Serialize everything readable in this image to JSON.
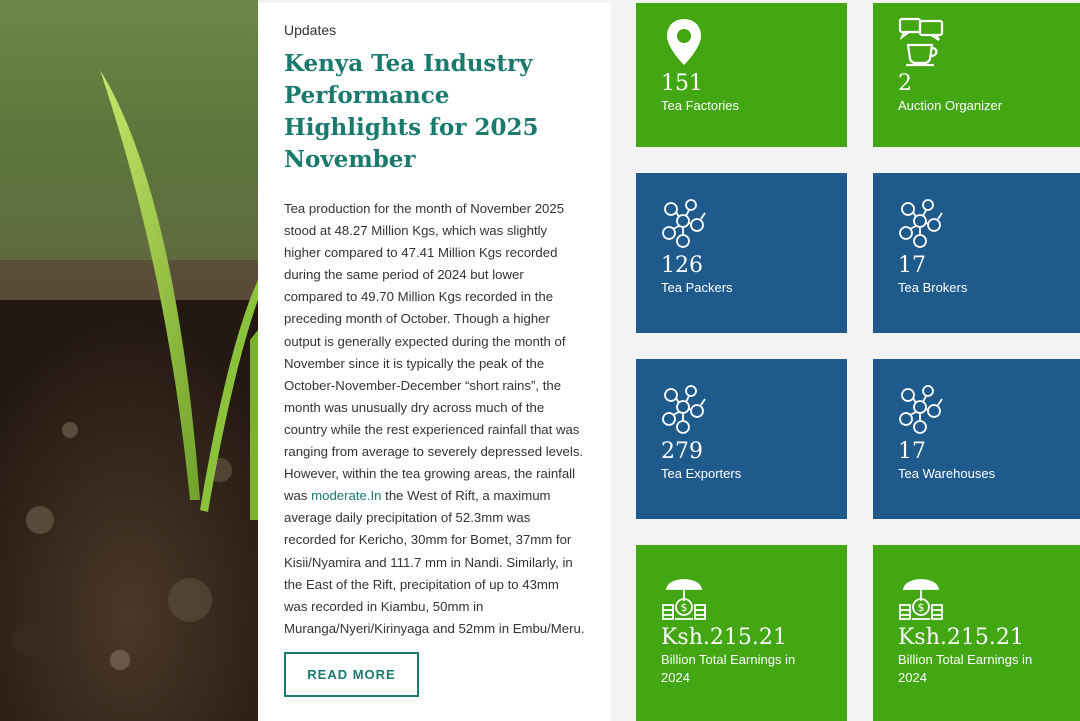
{
  "article": {
    "kicker": "Updates",
    "title": "Kenya Tea Industry Performance Highlights for 2025 November",
    "body_before_link": "Tea production for the month of November 2025 stood at 48.27 Million Kgs, which was slightly higher compared to 47.41 Million Kgs recorded during the same period of 2024 but lower compared to 49.70 Million Kgs recorded in the preceding month of October. Though a higher output is generally expected during the month of November since it is typically the peak of the October-November-December “short rains”, the month was unusually dry across much of the country while the rest experienced rainfall that was ranging from average to severely depressed levels. However, within the tea growing areas, the rainfall was ",
    "body_link": "moderate.In",
    "body_after_link": " the West of Rift, a maximum average daily precipitation of 52.3mm was recorded for Kericho, 30mm for Bomet, 37mm for Kisii/Nyamira and 111.7 mm in Nandi. Similarly, in the East of the Rift, precipitation of up to 43mm was recorded in Kiambu, 50mm in Muranga/Nyeri/Kirinyaga and 52mm in Embu/Meru.",
    "read_more": "READ MORE"
  },
  "stats": [
    {
      "value": "151",
      "label": "Tea Factories",
      "icon": "location-pin-icon",
      "color": "#43a613"
    },
    {
      "value": "2",
      "label": "Auction Organizer",
      "icon": "chat-cup-icon",
      "color": "#43a613"
    },
    {
      "value": "126",
      "label": "Tea Packers",
      "icon": "network-people-icon",
      "color": "#1f5a8c"
    },
    {
      "value": "17",
      "label": "Tea Brokers",
      "icon": "network-people-icon",
      "color": "#1f5a8c"
    },
    {
      "value": "279",
      "label": "Tea Exporters",
      "icon": "network-people-icon",
      "color": "#1f5a8c"
    },
    {
      "value": "17",
      "label": "Tea Warehouses",
      "icon": "network-people-icon",
      "color": "#1f5a8c"
    },
    {
      "value": "Ksh.215.21",
      "label": "Billion Total Earnings in 2024",
      "icon": "money-umbrella-icon",
      "color": "#43a613"
    },
    {
      "value": "Ksh.215.21",
      "label": "Billion Total Earnings in 2024",
      "icon": "money-umbrella-icon",
      "color": "#43a613"
    }
  ]
}
